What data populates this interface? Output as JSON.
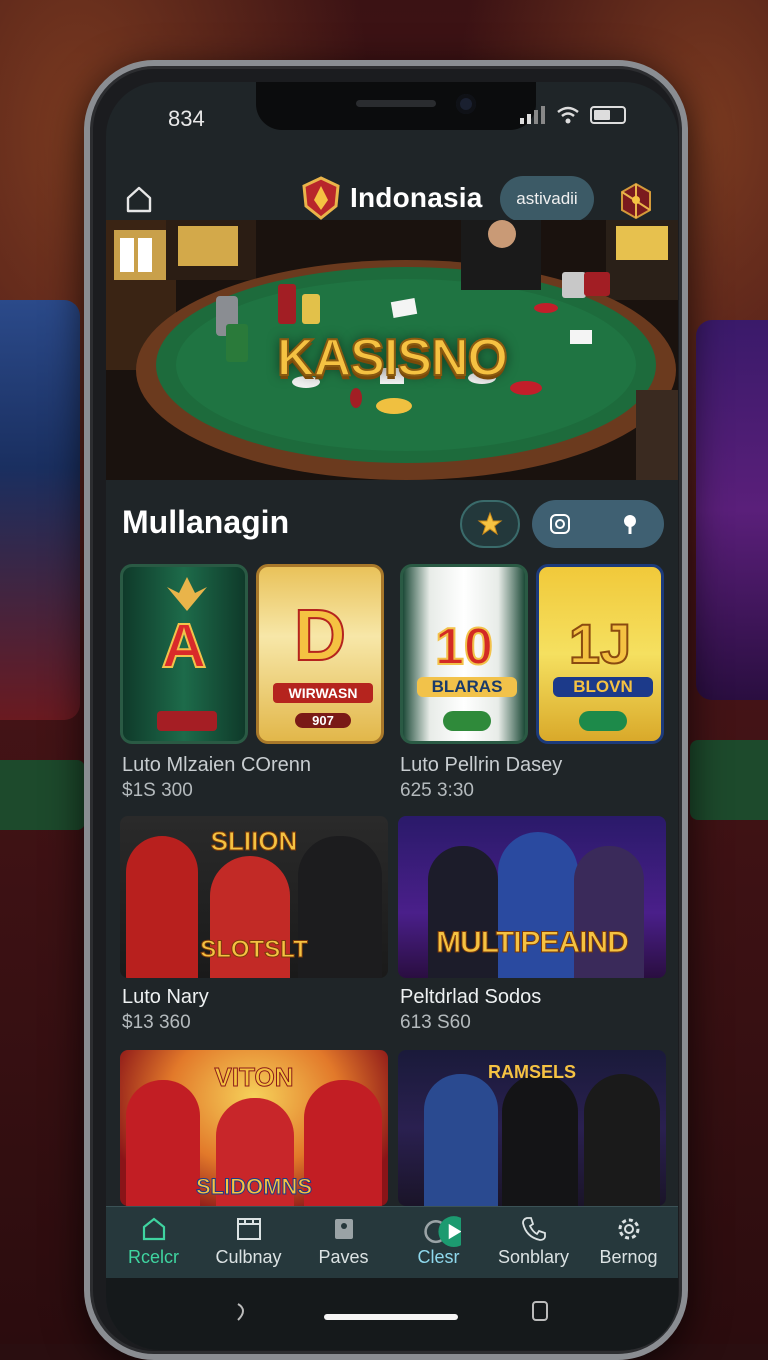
{
  "status_bar": {
    "time": "834"
  },
  "header": {
    "title": "Indonasia",
    "activate_label": "astivadii"
  },
  "hero": {
    "title": "KASISNO"
  },
  "section": {
    "title": "Mullanagin"
  },
  "slots": [
    {
      "symbol": "A",
      "banner": ""
    },
    {
      "symbol": "D",
      "banner": "WIRWASN",
      "sub": "907"
    },
    {
      "symbol": "10",
      "banner": "BLARAS"
    },
    {
      "symbol": "1J",
      "banner": "BLOVN"
    }
  ],
  "slot_captions": [
    {
      "name": "Luto Mlzaien COrenn",
      "value": "$1S 300"
    },
    {
      "name": "Luto Pellrin Dasey",
      "value": "625 3:30"
    }
  ],
  "cards": [
    {
      "title": "SLIION",
      "subtitle": "SLOTSLT",
      "name": "Luto Nary",
      "value": "$13 360"
    },
    {
      "title": "MULTIPEAIND",
      "subtitle": "",
      "name": "Peltdrlad Sodos",
      "value": "613 S60"
    },
    {
      "title": "VITON",
      "subtitle": "SLIDOMNS",
      "name": "",
      "value": ""
    },
    {
      "title": "RAMSELS",
      "subtitle": "",
      "name": "",
      "value": ""
    }
  ],
  "tabs": [
    {
      "label": "Rcelcr",
      "icon": "home-icon",
      "active": true
    },
    {
      "label": "Culbnay",
      "icon": "film-icon",
      "active": false
    },
    {
      "label": "Paves",
      "icon": "tag-icon",
      "active": false
    },
    {
      "label": "Clesr",
      "icon": "play-icon",
      "active": false
    },
    {
      "label": "Sonblary",
      "icon": "phone-icon",
      "active": false
    },
    {
      "label": "Bernog",
      "icon": "gear-icon",
      "active": false
    }
  ],
  "colors": {
    "accent": "#3fd4a0",
    "header_button": "#3c5a66",
    "tabbar": "#26383c",
    "hero_title": "#f5c242"
  }
}
